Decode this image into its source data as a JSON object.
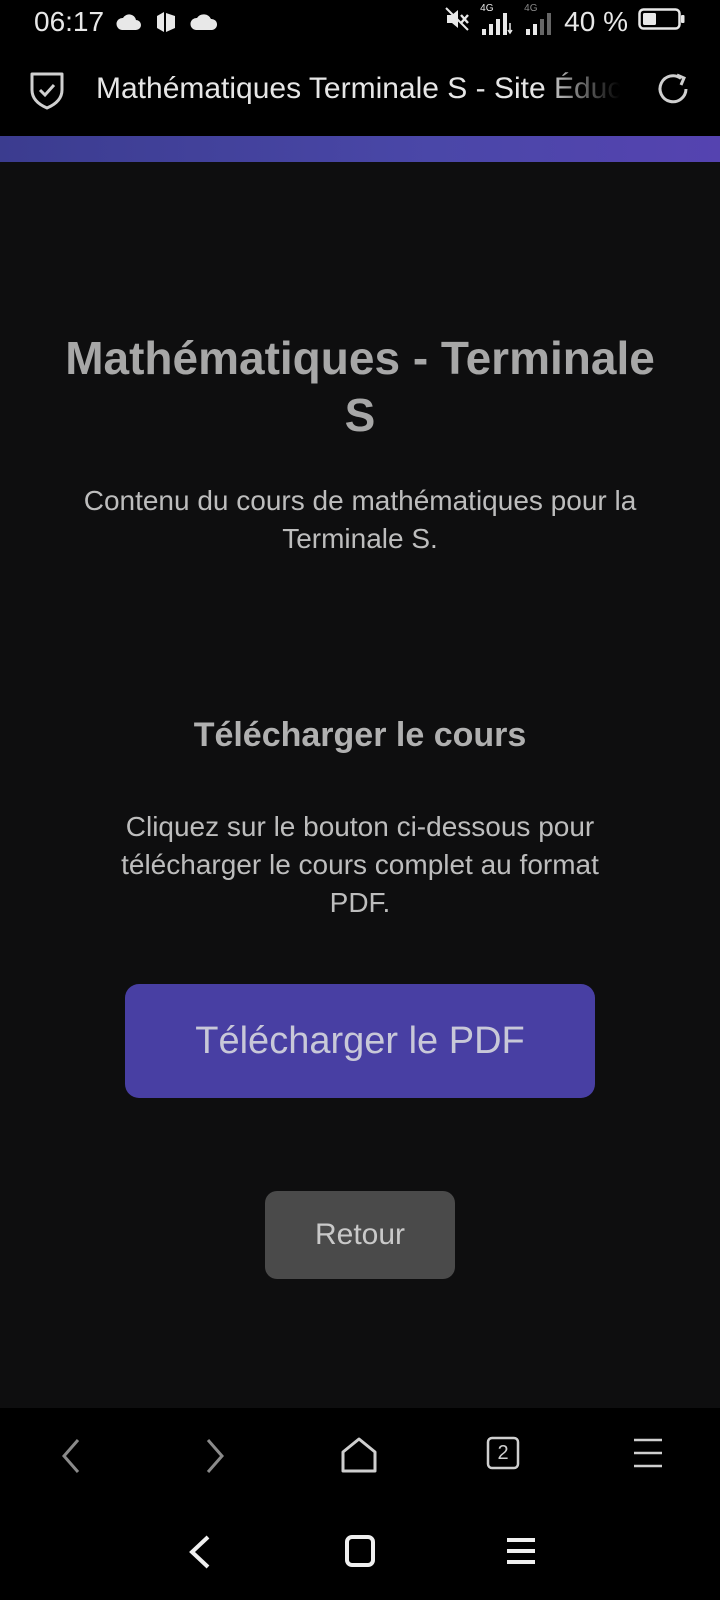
{
  "status_bar": {
    "time": "06:17",
    "network_label_1": "4G",
    "network_label_2": "4G",
    "battery_percent": "40 %",
    "battery_level": 0.4,
    "icons": [
      "cloud-icon",
      "notification-app-icon",
      "cloud-icon",
      "mute-icon",
      "signal-icon",
      "signal-icon",
      "battery-icon"
    ]
  },
  "browser": {
    "page_title": "Mathématiques Terminale S - Site Éducatif",
    "tab_count": "2"
  },
  "main": {
    "course_title": "Mathématiques - Terminale S",
    "course_description": "Contenu du cours de mathématiques pour la Terminale S.",
    "section_title": "Télécharger le cours",
    "section_description": "Cliquez sur le bouton ci-dessous pour télécharger le cours complet au format PDF.",
    "download_button_label": "Télécharger le PDF",
    "back_button_label": "Retour"
  },
  "colors": {
    "accent": "#483fa3",
    "background": "#0e0e0f",
    "secondary_button": "#4a4a4a"
  }
}
